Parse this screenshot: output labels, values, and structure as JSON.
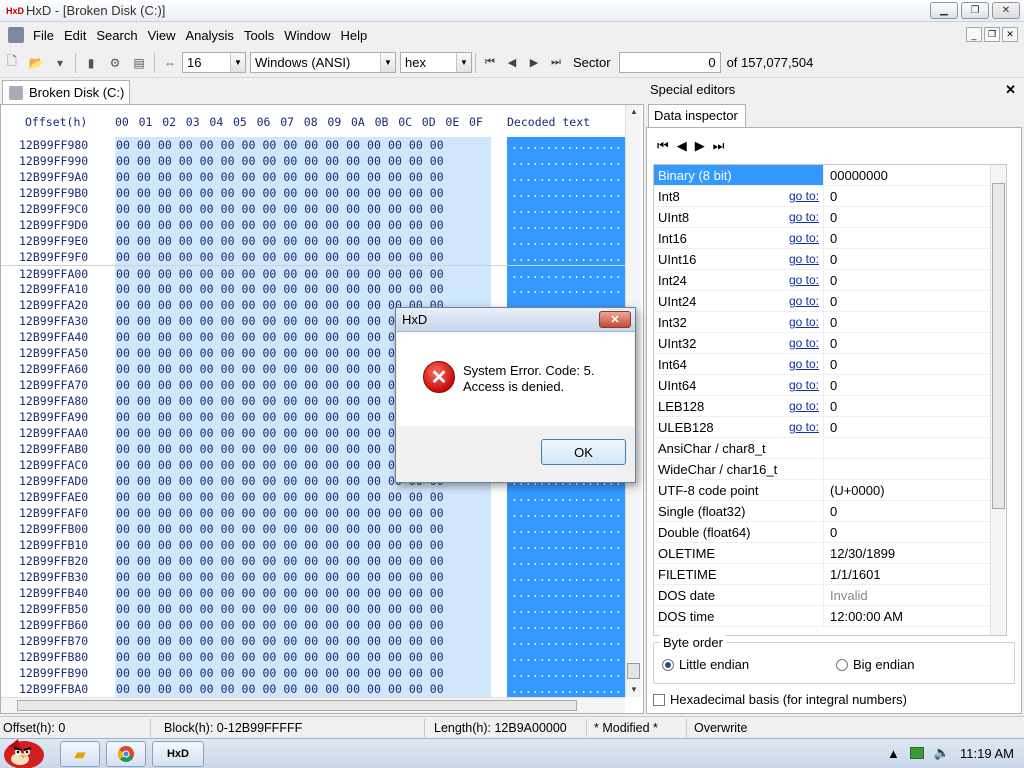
{
  "window": {
    "title": "HxD - [Broken Disk (C:)]",
    "app_icon_text": "HxD",
    "minimize": "▁",
    "maximize": "❐",
    "close": "✕"
  },
  "menu": [
    "File",
    "Edit",
    "Search",
    "View",
    "Analysis",
    "Tools",
    "Window",
    "Help"
  ],
  "toolbar": {
    "bytes_per_row": "16",
    "charset": "Windows (ANSI)",
    "number_base": "hex",
    "sector_label": "Sector",
    "sector_value": "0",
    "sector_total": "of 157,077,504"
  },
  "document_tab": "Broken Disk (C:)",
  "hex": {
    "offset_header": "Offset(h)",
    "columns": [
      "00",
      "01",
      "02",
      "03",
      "04",
      "05",
      "06",
      "07",
      "08",
      "09",
      "0A",
      "0B",
      "0C",
      "0D",
      "0E",
      "0F"
    ],
    "decoded_header": "Decoded text",
    "offsets": [
      "12B99FF980",
      "12B99FF990",
      "12B99FF9A0",
      "12B99FF9B0",
      "12B99FF9C0",
      "12B99FF9D0",
      "12B99FF9E0",
      "12B99FF9F0",
      "12B99FFA00",
      "12B99FFA10",
      "12B99FFA20",
      "12B99FFA30",
      "12B99FFA40",
      "12B99FFA50",
      "12B99FFA60",
      "12B99FFA70",
      "12B99FFA80",
      "12B99FFA90",
      "12B99FFAA0",
      "12B99FFAB0",
      "12B99FFAC0",
      "12B99FFAD0",
      "12B99FFAE0",
      "12B99FFAF0",
      "12B99FFB00",
      "12B99FFB10",
      "12B99FFB20",
      "12B99FFB30",
      "12B99FFB40",
      "12B99FFB50",
      "12B99FFB60",
      "12B99FFB70",
      "12B99FFB80",
      "12B99FFB90",
      "12B99FFBA0"
    ],
    "row_bytes": "00 00 00 00 00 00 00 00 00 00 00 00 00 00 00 00",
    "row_decoded": "................"
  },
  "special_editors": {
    "header": "Special editors",
    "close": "✕",
    "tab": "Data inspector",
    "goto_label": "go to:",
    "rows": [
      {
        "name": "Binary (8 bit)",
        "value": "00000000",
        "goto": false
      },
      {
        "name": "Int8",
        "value": "0",
        "goto": true
      },
      {
        "name": "UInt8",
        "value": "0",
        "goto": true
      },
      {
        "name": "Int16",
        "value": "0",
        "goto": true
      },
      {
        "name": "UInt16",
        "value": "0",
        "goto": true
      },
      {
        "name": "Int24",
        "value": "0",
        "goto": true
      },
      {
        "name": "UInt24",
        "value": "0",
        "goto": true
      },
      {
        "name": "Int32",
        "value": "0",
        "goto": true
      },
      {
        "name": "UInt32",
        "value": "0",
        "goto": true
      },
      {
        "name": "Int64",
        "value": "0",
        "goto": true
      },
      {
        "name": "UInt64",
        "value": "0",
        "goto": true
      },
      {
        "name": "LEB128",
        "value": "0",
        "goto": true
      },
      {
        "name": "ULEB128",
        "value": "0",
        "goto": true
      },
      {
        "name": "AnsiChar / char8_t",
        "value": "",
        "goto": false
      },
      {
        "name": "WideChar / char16_t",
        "value": "",
        "goto": false
      },
      {
        "name": "UTF-8 code point",
        "value": "   (U+0000)",
        "goto": false
      },
      {
        "name": "Single (float32)",
        "value": "0",
        "goto": false
      },
      {
        "name": "Double (float64)",
        "value": "0",
        "goto": false
      },
      {
        "name": "OLETIME",
        "value": "12/30/1899",
        "goto": false
      },
      {
        "name": "FILETIME",
        "value": "1/1/1601",
        "goto": false
      },
      {
        "name": "DOS date",
        "value": "Invalid",
        "goto": false,
        "gray": true
      },
      {
        "name": "DOS time",
        "value": "12:00:00 AM",
        "goto": false
      }
    ],
    "byte_order_label": "Byte order",
    "little_endian": "Little endian",
    "big_endian": "Big endian",
    "hex_basis": "Hexadecimal basis (for integral numbers)"
  },
  "status": {
    "offset": "Offset(h): 0",
    "block": "Block(h): 0-12B99FFFFF",
    "length": "Length(h): 12B9A00000",
    "modified": "* Modified *",
    "mode": "Overwrite"
  },
  "taskbar": {
    "hxd_label": "HxD",
    "clock": "11:19 AM"
  },
  "dialog": {
    "title": "HxD",
    "close": "✕",
    "line1": "System Error.  Code: 5.",
    "line2": "Access is denied.",
    "ok": "OK"
  },
  "colors": {
    "selection": "#3399ff",
    "hex_bg": "#cfe6fb",
    "link": "#0a2fa8"
  }
}
